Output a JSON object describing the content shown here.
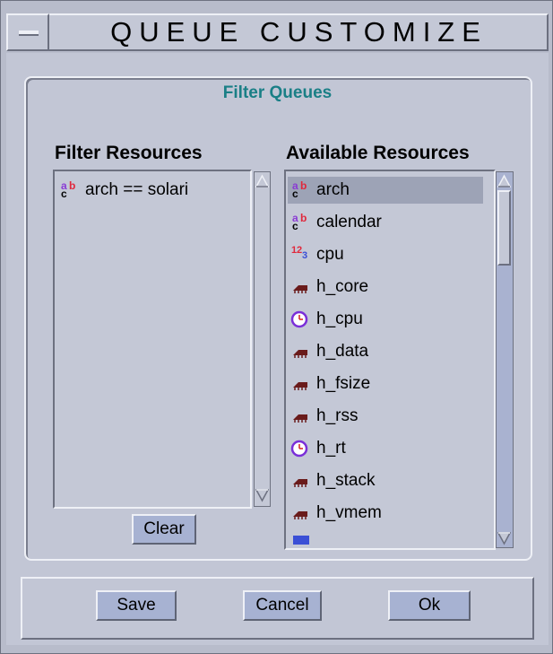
{
  "window": {
    "title": "QUEUE CUSTOMIZE"
  },
  "group": {
    "title": "Filter Queues"
  },
  "filter_resources": {
    "label": "Filter Resources",
    "items": [
      {
        "icon": "string-icon",
        "text": "arch == solari"
      }
    ],
    "clear_label": "Clear"
  },
  "available_resources": {
    "label": "Available Resources",
    "items": [
      {
        "icon": "string-icon",
        "text": "arch",
        "selected": true
      },
      {
        "icon": "string-icon",
        "text": "calendar"
      },
      {
        "icon": "numeric-icon",
        "text": "cpu"
      },
      {
        "icon": "memory-icon",
        "text": "h_core"
      },
      {
        "icon": "clock-icon",
        "text": "h_cpu"
      },
      {
        "icon": "memory-icon",
        "text": "h_data"
      },
      {
        "icon": "memory-icon",
        "text": "h_fsize"
      },
      {
        "icon": "memory-icon",
        "text": "h_rss"
      },
      {
        "icon": "clock-icon",
        "text": "h_rt"
      },
      {
        "icon": "memory-icon",
        "text": "h_stack"
      },
      {
        "icon": "memory-icon",
        "text": "h_vmem"
      }
    ]
  },
  "buttons": {
    "save": "Save",
    "cancel": "Cancel",
    "ok": "Ok"
  }
}
